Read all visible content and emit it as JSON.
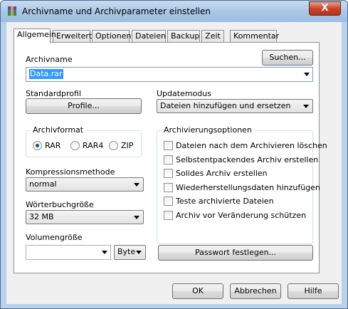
{
  "window": {
    "title": "Archivname und Archivparameter einstellen",
    "close_glyph": "X"
  },
  "tabs": [
    {
      "label": "Allgemein",
      "active": true
    },
    {
      "label": "Erweitert",
      "active": false
    },
    {
      "label": "Optionen",
      "active": false
    },
    {
      "label": "Dateien",
      "active": false
    },
    {
      "label": "Backup",
      "active": false
    },
    {
      "label": "Zeit",
      "active": false
    },
    {
      "label": "Kommentar",
      "active": false
    }
  ],
  "archive": {
    "name_label": "Archivname",
    "browse_label": "Suchen...",
    "name_value": "Data.rar"
  },
  "profile": {
    "label": "Standardprofil",
    "button": "Profile..."
  },
  "update": {
    "label": "Updatemodus",
    "value": "Dateien hinzufügen und ersetzen"
  },
  "format": {
    "title": "Archivformat",
    "options": [
      {
        "label": "RAR",
        "selected": true
      },
      {
        "label": "RAR4",
        "selected": false
      },
      {
        "label": "ZIP",
        "selected": false
      }
    ]
  },
  "compression": {
    "label": "Kompressionsmethode",
    "value": "normal"
  },
  "dictionary": {
    "label": "Wörterbuchgröße",
    "value": "32 MB"
  },
  "volume": {
    "label": "Volumengröße",
    "value": "",
    "unit": "Byte"
  },
  "archiving_options": {
    "title": "Archivierungsoptionen",
    "items": [
      {
        "label": "Dateien nach dem Archivieren löschen",
        "checked": false
      },
      {
        "label": "Selbstentpackendes Archiv erstellen",
        "checked": false
      },
      {
        "label": "Solides Archiv erstellen",
        "checked": false
      },
      {
        "label": "Wiederherstellungsdaten hinzufügen",
        "checked": false
      },
      {
        "label": "Teste archivierte Dateien",
        "checked": false
      },
      {
        "label": "Archiv vor Veränderung schützen",
        "checked": false
      }
    ]
  },
  "password_button": "Passwort festlegen...",
  "footer": {
    "ok": "OK",
    "cancel": "Abbrechen",
    "help": "Hilfe"
  },
  "colors": {
    "frame": "#b9d1ea",
    "selection": "#3399ff",
    "close_button": "#c9452a"
  }
}
